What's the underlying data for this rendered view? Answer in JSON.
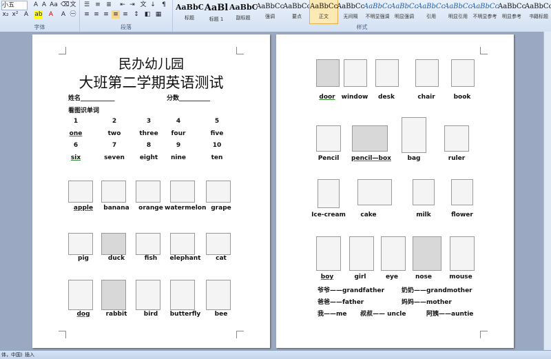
{
  "ribbon": {
    "font_box": "小五",
    "font_group_label": "字体",
    "para_group_label": "段落",
    "style_group_label": "样式",
    "styles": [
      {
        "sample": "AaBbC",
        "name": "标题"
      },
      {
        "sample": "AaBl",
        "name": "标题 1"
      },
      {
        "sample": "AaBbC",
        "name": "副标题"
      },
      {
        "sample": "AaBbCcD",
        "name": "强调"
      },
      {
        "sample": "AaBbCcD",
        "name": "要点"
      },
      {
        "sample": "AaBbCcD",
        "name": "正文"
      },
      {
        "sample": "AaBbCcD",
        "name": "无间隔"
      },
      {
        "sample": "AaBbCcD",
        "name": "不明显强调"
      },
      {
        "sample": "AaBbCcD",
        "name": "明显强调"
      },
      {
        "sample": "AaBbCcD",
        "name": "引用"
      },
      {
        "sample": "AaBbCcD",
        "name": "明显引用"
      },
      {
        "sample": "AaBbCcD",
        "name": "不明显参考"
      },
      {
        "sample": "AaBbCcD",
        "name": "明显参考"
      },
      {
        "sample": "AaBbCcI",
        "name": "书籍标题"
      }
    ]
  },
  "status": {
    "lang": "体，中国)",
    "mode": "插入"
  },
  "page1": {
    "title1": "民办幼儿园",
    "title2": "大班第二学期英语测试",
    "name_label": "姓名___________",
    "score_label": "分数__________",
    "section": "看图识单词",
    "numbers_row1": [
      "1",
      "2",
      "3",
      "4",
      "5"
    ],
    "words_row1": [
      "one",
      "two",
      "three",
      "four",
      "five"
    ],
    "numbers_row2": [
      "6",
      "7",
      "8",
      "9",
      "10"
    ],
    "words_row2": [
      "six",
      "seven",
      "eight",
      "nine",
      "ten"
    ],
    "fruits": [
      "apple",
      "banana",
      "orange",
      "watermelon",
      "grape"
    ],
    "animals1": [
      "pig",
      "duck",
      "fish",
      "elephant",
      "cat"
    ],
    "animals2": [
      "dog",
      "rabbit",
      "bird",
      "butterfly",
      "bee"
    ]
  },
  "page2": {
    "row1": [
      "door",
      "window",
      "desk",
      "chair",
      "book"
    ],
    "row2": [
      "Pencil",
      "pencil—box",
      "bag",
      "ruler"
    ],
    "row3": [
      "Ice-cream",
      "cake",
      "milk",
      "flower"
    ],
    "row4": [
      "boy",
      "girl",
      "eye",
      "nose",
      "mouse"
    ],
    "family": [
      {
        "left": "爷爷——grandfather",
        "right": "奶奶——grandmother"
      },
      {
        "left": "爸爸——father",
        "right": "妈妈——mother"
      },
      {
        "left": "我——me",
        "mid": "叔叔—— uncle",
        "right": "阿姨——auntie"
      }
    ]
  }
}
